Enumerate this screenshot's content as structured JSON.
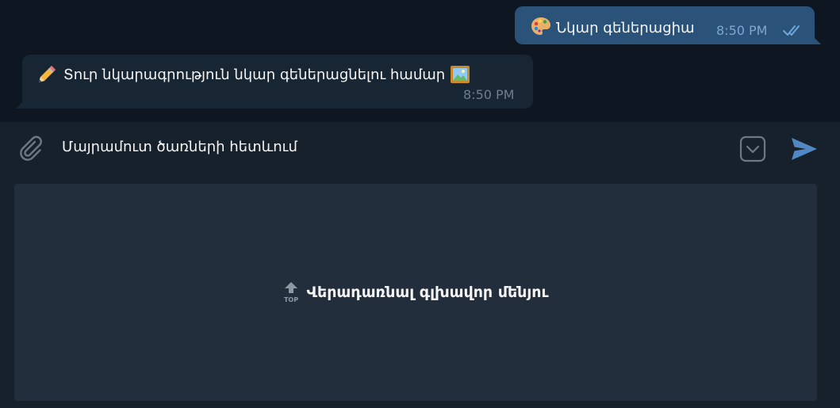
{
  "messages": {
    "outgoing": {
      "emoji": "palette-emoji",
      "text": "Նկար գեներացիա",
      "time": "8:50 PM",
      "status": "read"
    },
    "incoming": {
      "emoji_start": "pencil-emoji",
      "text": "Տուր նկարագրություն նկար գեներացնելու համար",
      "emoji_end": "framed-picture-emoji",
      "time": "8:50 PM"
    }
  },
  "composer": {
    "input_value": "Մայրամուտ ծառների հետևում",
    "icons": [
      "paperclip-icon",
      "keyboard-toggle-icon",
      "send-icon"
    ]
  },
  "reply_keyboard": {
    "buttons": [
      {
        "icon": "top-arrow-icon",
        "label": "Վերադառնալ գլխավոր մենյու"
      }
    ]
  },
  "colors": {
    "chat_background": "#0e1621",
    "outgoing_bubble": "#2b5278",
    "incoming_bubble": "#182533",
    "composer_background": "#17212b",
    "keyboard_button": "#232e3c",
    "accent": "#5288c1"
  }
}
